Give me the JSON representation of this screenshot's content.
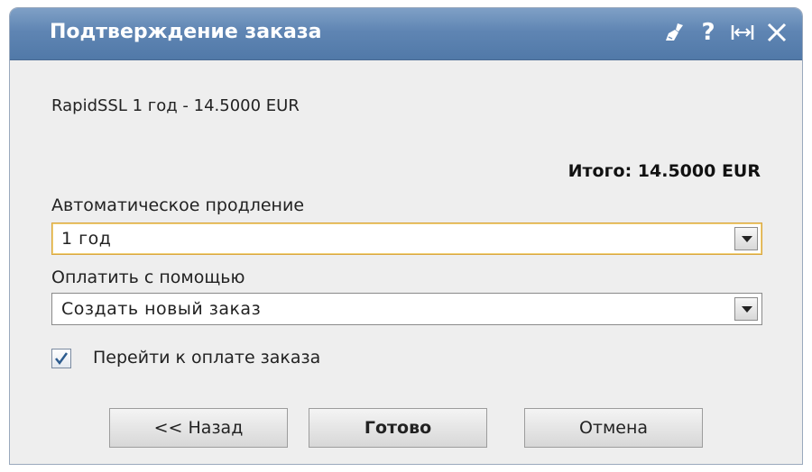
{
  "dialog": {
    "title": "Подтверждение заказа",
    "icons": [
      "broom-icon",
      "help-icon",
      "resize-icon",
      "close-icon"
    ],
    "help_glyph": "?"
  },
  "order": {
    "line": "RapidSSL 1 год - 14.5000 EUR",
    "total": "Итого: 14.5000 EUR"
  },
  "auto_renew": {
    "label": "Автоматическое продление",
    "value": "1 год"
  },
  "payment": {
    "label": "Оплатить с помощью",
    "value": "Создать новый заказ"
  },
  "go_to_payment": {
    "label": "Перейти к оплате заказа",
    "checked": true
  },
  "buttons": {
    "back": "<< Назад",
    "done": "Готово",
    "cancel": "Отмена"
  },
  "colors": {
    "titlebar": "#5f85b3",
    "body": "#eeeeee",
    "focus_border": "#d9a640"
  }
}
